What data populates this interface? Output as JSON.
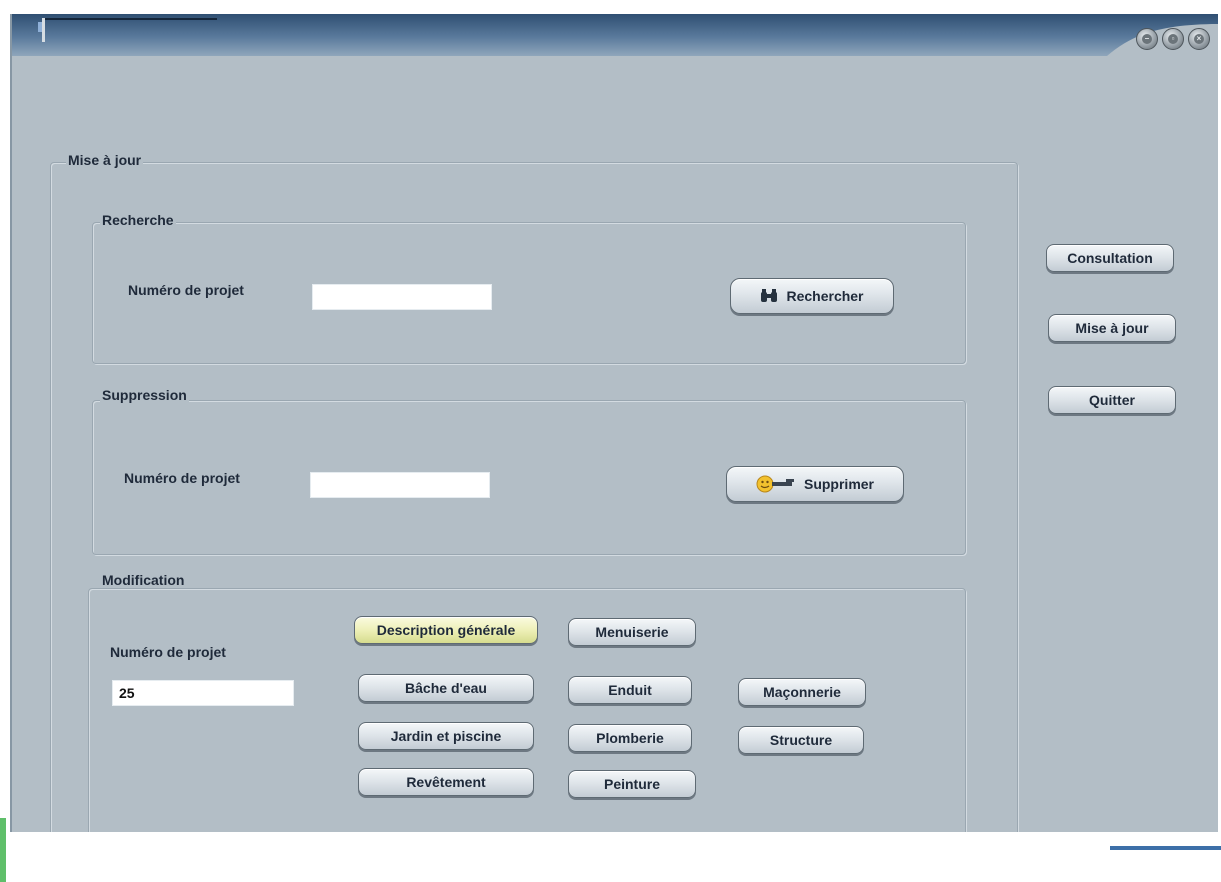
{
  "window": {
    "title": ""
  },
  "update_group": {
    "title": "Mise à jour"
  },
  "search_group": {
    "title": "Recherche",
    "field_label": "Numéro de projet",
    "field_value": "",
    "button_label": "Rechercher",
    "button_icon": "binoculars-icon"
  },
  "delete_group": {
    "title": "Suppression",
    "field_label": "Numéro de projet",
    "field_value": "",
    "button_label": "Supprimer",
    "button_icon": "key-icon"
  },
  "modify_group": {
    "title": "Modification",
    "field_label": "Numéro de projet",
    "field_value": "25",
    "buttons": [
      {
        "label": "Description générale",
        "active": true
      },
      {
        "label": "Menuiserie"
      },
      {
        "label": "Bâche d'eau"
      },
      {
        "label": "Enduit"
      },
      {
        "label": "Maçonnerie"
      },
      {
        "label": "Jardin et piscine"
      },
      {
        "label": "Plomberie"
      },
      {
        "label": "Structure"
      },
      {
        "label": "Revêtement"
      },
      {
        "label": "Peinture"
      }
    ]
  },
  "side_menu": {
    "consultation": "Consultation",
    "update": "Mise à jour",
    "quit": "Quitter"
  },
  "colors": {
    "window_bg": "#b3bec6",
    "titlebar": "#4e6f92",
    "active_button": "#eef0b8"
  }
}
